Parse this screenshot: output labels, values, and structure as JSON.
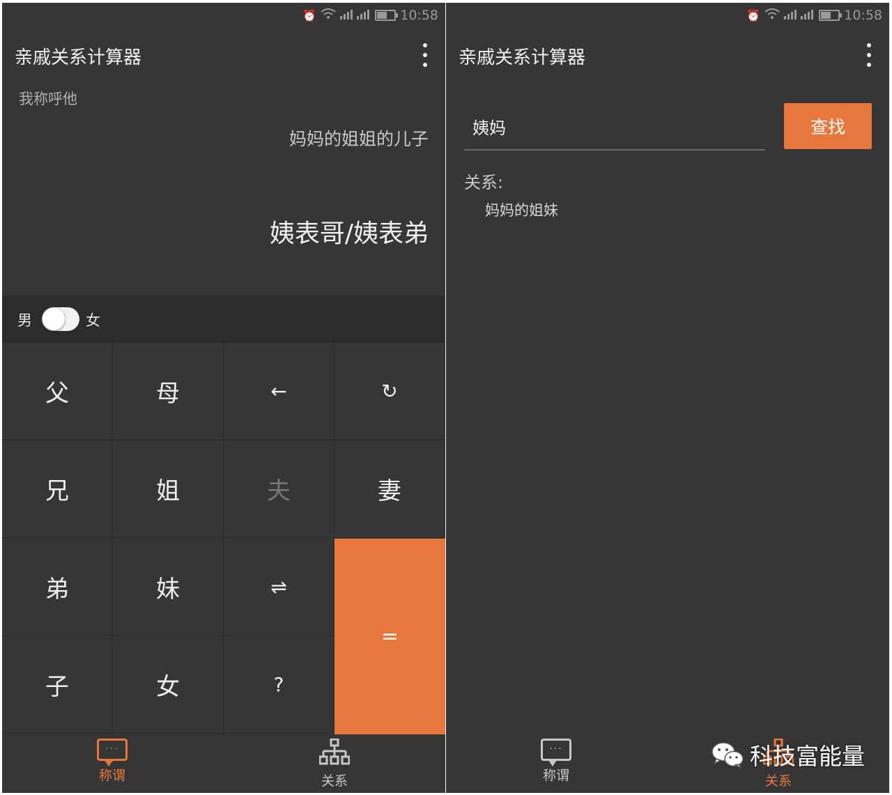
{
  "left_screen": {
    "status": {
      "time": "10:58"
    },
    "app_title": "亲戚关系计算器",
    "prompt_label": "我称呼他",
    "input_path": "妈妈的姐姐的儿子",
    "result": "姨表哥/姨表弟",
    "gender": {
      "male_label": "男",
      "female_label": "女",
      "toggle_state": "male"
    },
    "keys": {
      "father": "父",
      "mother": "母",
      "backspace": "←",
      "reset": "↻",
      "elder_brother": "兄",
      "elder_sister": "姐",
      "husband": "夫",
      "wife": "妻",
      "younger_brother": "弟",
      "younger_sister": "妹",
      "swap": "⇌",
      "equals": "=",
      "son": "子",
      "daughter": "女",
      "question": "?"
    },
    "tabs": [
      {
        "label": "称谓",
        "icon": "chat-icon",
        "active": true
      },
      {
        "label": "关系",
        "icon": "tree-icon",
        "active": false
      }
    ]
  },
  "right_screen": {
    "status": {
      "time": "10:58"
    },
    "app_title": "亲戚关系计算器",
    "search": {
      "value": "姨妈",
      "button_label": "查找"
    },
    "relation_label": "关系:",
    "relation_value": "妈妈的姐妹",
    "tabs": [
      {
        "label": "称谓",
        "icon": "chat-icon",
        "active": false
      },
      {
        "label": "关系",
        "icon": "tree-icon",
        "active": true
      }
    ]
  },
  "watermark": {
    "text": "科技富能量",
    "icon": "wechat-icon"
  },
  "colors": {
    "background": "#363636",
    "accent": "#e8773d",
    "toolbar_dark": "#2c2c2c"
  }
}
